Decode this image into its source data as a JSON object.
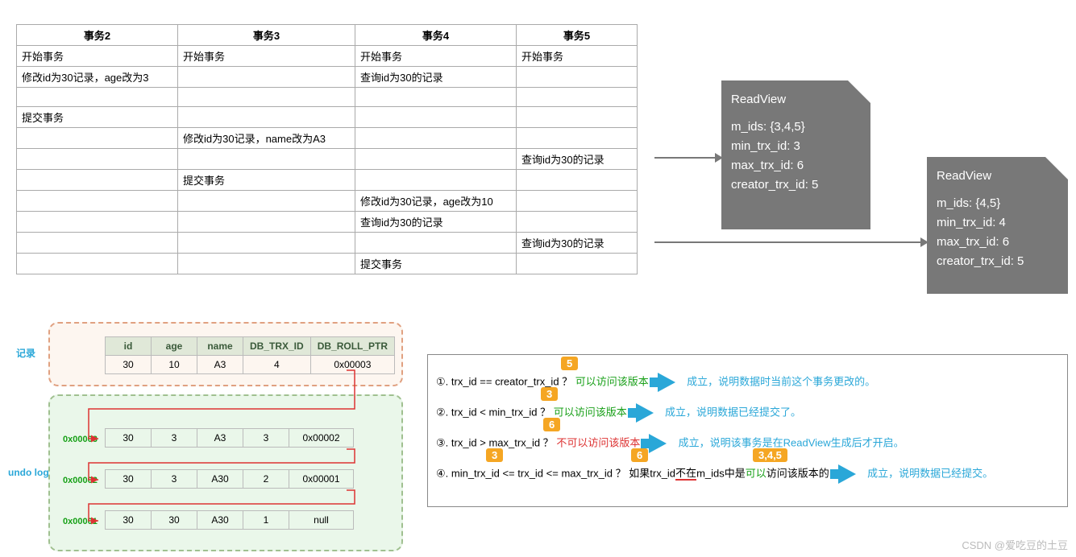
{
  "table": {
    "headers": [
      "事务2",
      "事务3",
      "事务4",
      "事务5"
    ],
    "rows": [
      [
        "开始事务",
        "开始事务",
        "开始事务",
        "开始事务"
      ],
      [
        "修改id为30记录，age改为3",
        "",
        "查询id为30的记录",
        ""
      ],
      [
        "",
        "",
        "",
        ""
      ],
      [
        "提交事务",
        "",
        "",
        ""
      ],
      [
        "",
        "修改id为30记录，name改为A3",
        "",
        ""
      ],
      [
        "",
        "",
        "",
        "查询id为30的记录"
      ],
      [
        "",
        "提交事务",
        "",
        ""
      ],
      [
        "",
        "",
        "修改id为30记录，age改为10",
        ""
      ],
      [
        "",
        "",
        "查询id为30的记录",
        ""
      ],
      [
        "",
        "",
        "",
        "查询id为30的记录"
      ],
      [
        "",
        "",
        "提交事务",
        ""
      ]
    ]
  },
  "rv1": {
    "title": "ReadView",
    "m_ids": "m_ids: {3,4,5}",
    "min": "min_trx_id: 3",
    "max": "max_trx_id: 6",
    "creator": "creator_trx_id: 5"
  },
  "rv2": {
    "title": "ReadView",
    "m_ids": "m_ids: {4,5}",
    "min": "min_trx_id: 4",
    "max": "max_trx_id: 6",
    "creator": "creator_trx_id: 5"
  },
  "labels": {
    "record": "记录",
    "undo": "undo log"
  },
  "rec_headers": [
    "id",
    "age",
    "name",
    "DB_TRX_ID",
    "DB_ROLL_PTR"
  ],
  "rec_row": [
    "30",
    "10",
    "A3",
    "4",
    "0x00003"
  ],
  "undo_rows": [
    [
      "30",
      "3",
      "A3",
      "3",
      "0x00002"
    ],
    [
      "30",
      "3",
      "A30",
      "2",
      "0x00001"
    ],
    [
      "30",
      "30",
      "A30",
      "1",
      "null"
    ]
  ],
  "addrs": [
    "0x00003",
    "0x00002",
    "0x00001"
  ],
  "rules": {
    "r1": {
      "tag": "5",
      "pre": "①. trx_id  == creator_trx_id ？",
      "res": "可以访问该版本",
      "comment": "成立，说明数据时当前这个事务更改的。"
    },
    "r2": {
      "tag": "3",
      "pre": "②. trx_id < min_trx_id ？",
      "res": "可以访问该版本",
      "comment": "成立，说明数据已经提交了。"
    },
    "r3": {
      "tag": "6",
      "pre": "③. trx_id > max_trx_id ？",
      "res": "不可以访问该版本",
      "comment": "成立，说明该事务是在ReadView生成后才开启。"
    },
    "r4": {
      "t1": "3",
      "t2": "6",
      "t3": "3,4,5",
      "text1": "④. min_trx_id <= trx_id <= max_trx_id ？ 如果trx_id",
      "not_in": "不在",
      "text2": "m_ids中是",
      "can": "可以",
      "text3": "访问该版本的",
      "comment": "成立，说明数据已经提交。"
    }
  },
  "watermark": "CSDN @爱吃豆的土豆"
}
